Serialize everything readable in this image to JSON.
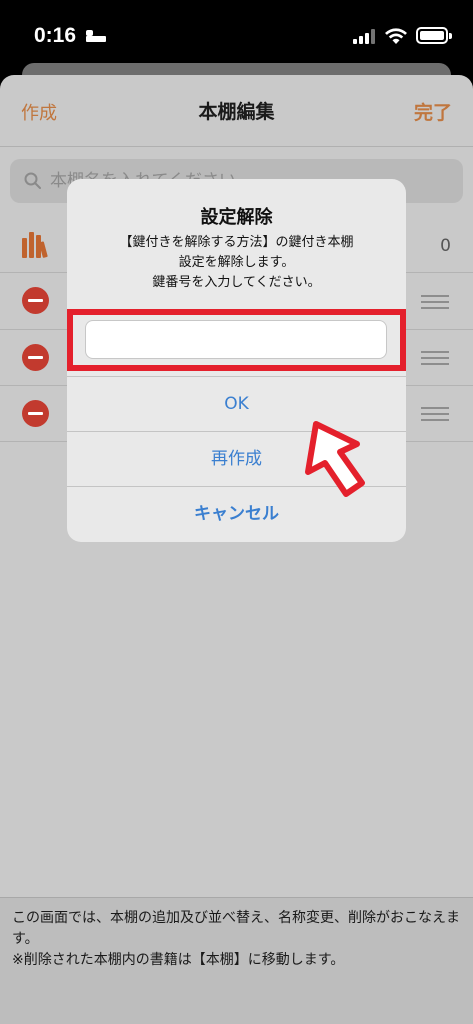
{
  "status_bar": {
    "time": "0:16"
  },
  "nav": {
    "left_label": "作成",
    "title": "本棚編集",
    "right_label": "完了"
  },
  "search": {
    "placeholder": "本棚名を入れてください"
  },
  "shelf_list": {
    "first_row_count": "0"
  },
  "footer": {
    "line1": "この画面では、本棚の追加及び並べ替え、名称変更、削除がおこなえます。",
    "line2": "※削除された本棚内の書籍は【本棚】に移動します。"
  },
  "alert": {
    "title": "設定解除",
    "message_line1": "【鍵付きを解除する方法】の鍵付き本棚",
    "message_line2": "設定を解除します。",
    "message_line3": "鍵番号を入力してください。",
    "input_value": "",
    "ok_label": "OK",
    "recreate_label": "再作成",
    "cancel_label": "キャンセル"
  },
  "colors": {
    "accent": "#c0763e",
    "alert_button": "#3a7fd0",
    "highlight": "#e4202c",
    "delete": "#c23a2e"
  }
}
